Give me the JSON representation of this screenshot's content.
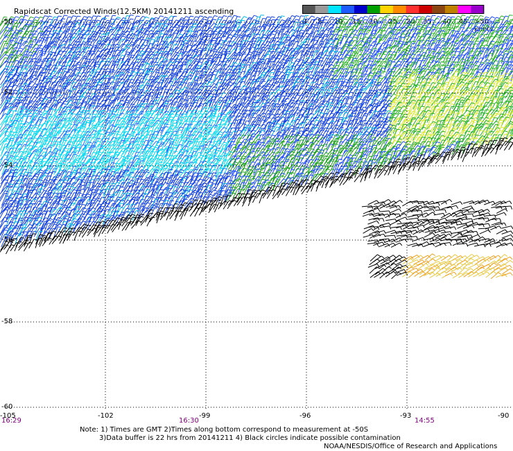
{
  "title": "Rapidscat Corrected Winds(12.5KM) 20141211 ascending",
  "legend": {
    "colors": [
      "#555555",
      "#999999",
      "#00e5ff",
      "#1e5bff",
      "#0000cc",
      "#00a000",
      "#ffd400",
      "#ff8c00",
      "#ff3030",
      "#cc0000",
      "#8b4513",
      "#c08000",
      "#ff00ff",
      "#9900cc"
    ],
    "labels": [
      "0",
      "5",
      "10",
      "15",
      "20",
      "25",
      "30",
      "35",
      "40",
      "45",
      ">50 knots"
    ]
  },
  "lat_labels": [
    "-50",
    "-52",
    "-54",
    "-56",
    "-58",
    "-60"
  ],
  "lon_labels": [
    "-105",
    "-102",
    "-99",
    "-96",
    "-93",
    "-90"
  ],
  "time_labels": [
    "16:29",
    "16:30",
    "14:55"
  ],
  "notes": {
    "line1": "Note: 1) Times are GMT 2)Times along bottom correspond to measurement at -50S",
    "line2": "3)Data buffer is 22 hrs from 20141211 4) Black circles indicate possible contamination",
    "line3": "NOAA/NESDIS/Office of Research and Applications"
  }
}
